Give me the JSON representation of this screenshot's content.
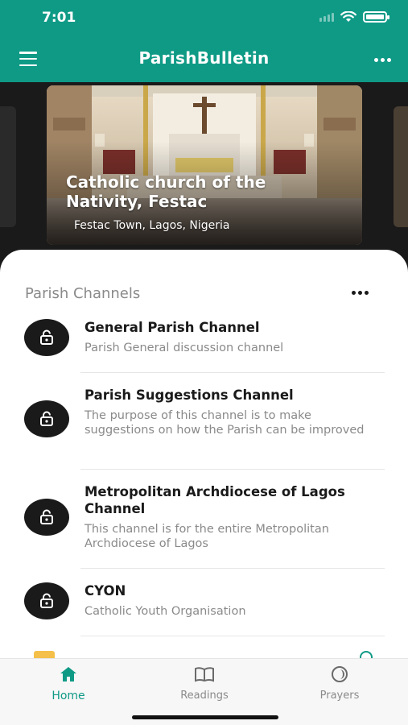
{
  "status": {
    "time": "7:01"
  },
  "header": {
    "title": "ParishBulletin",
    "menu_icon": "hamburger-icon",
    "more_icon": "more-horizontal-icon"
  },
  "hero": {
    "title": "Catholic church of the Nativity, Festac",
    "subtitle": "Festac Town, Lagos, Nigeria"
  },
  "channels_section": {
    "title": "Parish Channels",
    "items": [
      {
        "name": "General Parish Channel",
        "description": "Parish General discussion channel",
        "icon": "lock-icon"
      },
      {
        "name": "Parish Suggestions Channel",
        "description": "The purpose of this channel is to make suggestions on how the Parish can be improved",
        "icon": "lock-icon"
      },
      {
        "name": "Metropolitan Archdiocese of Lagos Channel",
        "description": "This channel is for the entire Metropolitan Archdiocese of Lagos",
        "icon": "lock-icon"
      },
      {
        "name": "CYON",
        "description": "Catholic Youth Organisation",
        "icon": "lock-icon"
      }
    ]
  },
  "tabs": [
    {
      "label": "Home",
      "icon": "home-icon",
      "active": true
    },
    {
      "label": "Readings",
      "icon": "book-icon",
      "active": false
    },
    {
      "label": "Prayers",
      "icon": "prayers-icon",
      "active": false
    }
  ],
  "colors": {
    "accent": "#0f9a86",
    "text": "#1a1a1a",
    "muted": "#8a8a8a"
  }
}
